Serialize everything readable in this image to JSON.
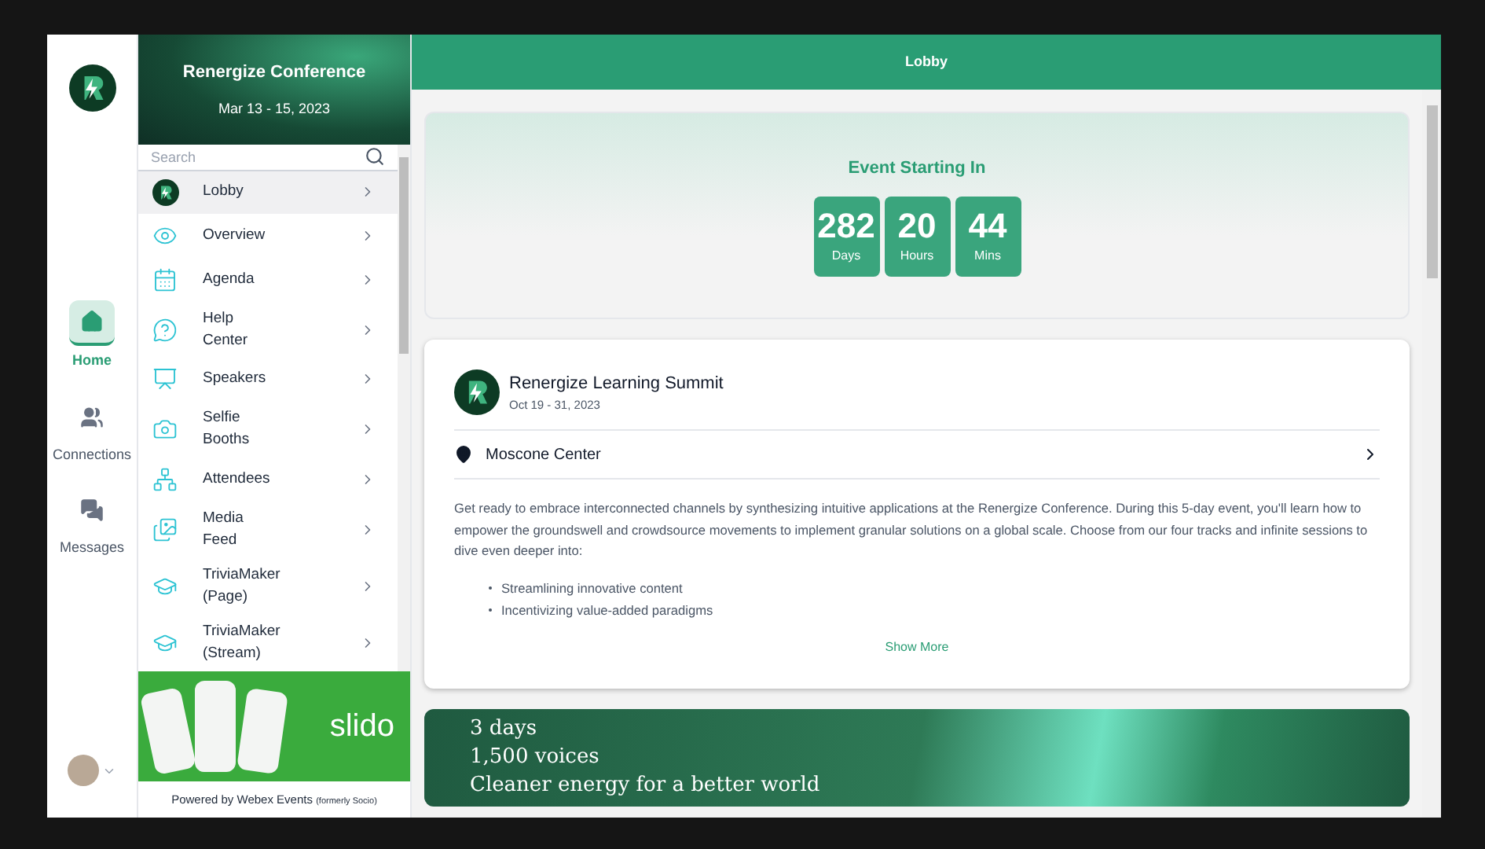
{
  "rail": {
    "items": [
      {
        "label": "Home",
        "selected": true
      },
      {
        "label": "Connections",
        "selected": false
      },
      {
        "label": "Messages",
        "selected": false
      }
    ]
  },
  "event_banner": {
    "title": "Renergize Conference",
    "dates": "Mar 13 - 15, 2023"
  },
  "search": {
    "placeholder": "Search"
  },
  "nav": {
    "items": [
      {
        "label": "Lobby",
        "selected": true
      },
      {
        "label": "Overview",
        "selected": false
      },
      {
        "label": "Agenda",
        "selected": false
      },
      {
        "label": "Help Center",
        "selected": false
      },
      {
        "label": "Speakers",
        "selected": false
      },
      {
        "label": "Selfie Booths",
        "selected": false
      },
      {
        "label": "Attendees",
        "selected": false
      },
      {
        "label": "Media Feed",
        "selected": false
      },
      {
        "label": "TriviaMaker (Page)",
        "selected": false
      },
      {
        "label": "TriviaMaker (Stream)",
        "selected": false
      }
    ]
  },
  "sponsor_banner": {
    "brand": "slido"
  },
  "footer": {
    "powered_by": "Powered by Webex Events",
    "note": "(formerly Socio)"
  },
  "header": {
    "title": "Lobby"
  },
  "countdown": {
    "title": "Event Starting In",
    "units": [
      {
        "value": "282",
        "label": "Days"
      },
      {
        "value": "20",
        "label": "Hours"
      },
      {
        "value": "44",
        "label": "Mins"
      }
    ]
  },
  "event_card": {
    "name": "Renergize Learning Summit",
    "dates": "Oct 19 - 31, 2023",
    "location": "Moscone Center",
    "description": "Get ready to embrace interconnected channels by synthesizing intuitive applications at the Renergize Conference. During this 5-day event, you'll learn how to empower the groundswell and crowdsource movements to implement granular solutions on a global scale. Choose from our four tracks and infinite sessions to dive even deeper into:",
    "bullets": [
      "Streamlining innovative content",
      "Incentivizing value-added paradigms"
    ],
    "show_more": "Show More"
  },
  "promo_banner": {
    "lines": [
      "3 days",
      "1,500 voices",
      "Cleaner energy for a better world"
    ]
  }
}
